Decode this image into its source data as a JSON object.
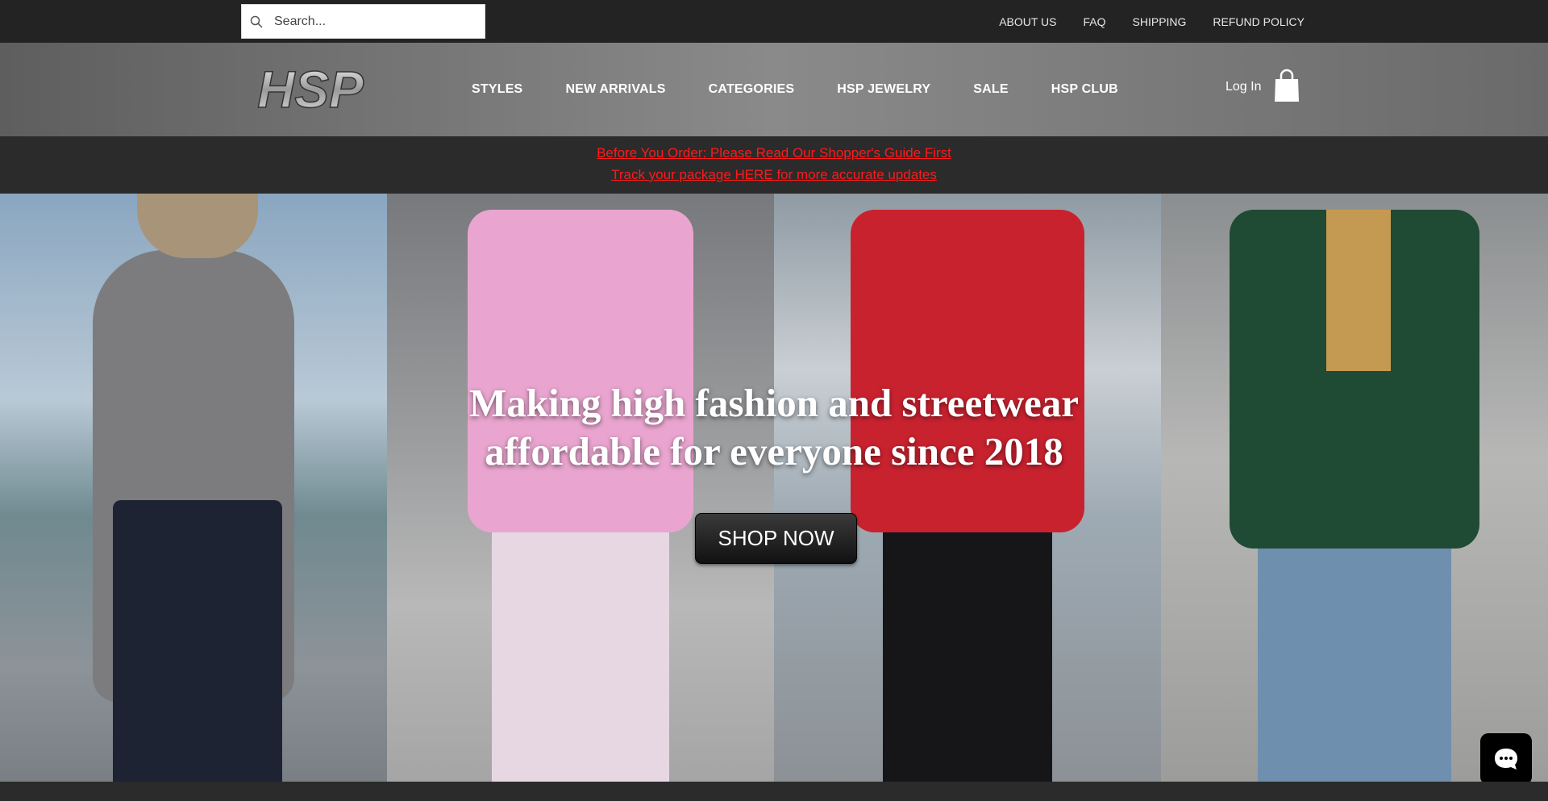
{
  "search": {
    "placeholder": "Search...",
    "icon": "search-icon"
  },
  "top_links": [
    "ABOUT US",
    "FAQ",
    "SHIPPING",
    "REFUND POLICY"
  ],
  "logo": {
    "text": "HSP"
  },
  "main_nav": [
    "STYLES",
    "NEW ARRIVALS",
    "CATEGORIES",
    "HSP JEWELRY",
    "SALE",
    "HSP CLUB"
  ],
  "account": {
    "login_label": "Log In",
    "cart_icon": "shopping-bag-icon"
  },
  "announcement": {
    "line1": "Before You Order: Please Read Our Shopper's Guide First",
    "line2": "Track your package HERE for more accurate updates",
    "color": "#ff1a1a"
  },
  "hero": {
    "title_line1": "Making high fashion and streetwear",
    "title_line2": "affordable for everyone since 2018",
    "cta_label": "SHOP NOW"
  },
  "chat": {
    "icon": "chat-bubble-icon"
  }
}
